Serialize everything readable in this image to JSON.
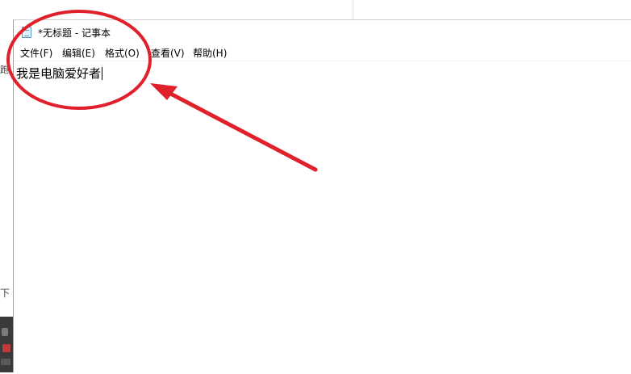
{
  "window": {
    "title": "*无标题 - 记事本",
    "app_icon": "notepad-icon"
  },
  "menu": {
    "file": "文件(F)",
    "edit": "编辑(E)",
    "format": "格式(O)",
    "view": "查看(V)",
    "help": "帮助(H)"
  },
  "editor": {
    "content": "我是电脑爱好者"
  },
  "background": {
    "left_glyph_1": "跑",
    "left_glyph_2": "下"
  },
  "colors": {
    "annotation_red": "#e0202a"
  }
}
